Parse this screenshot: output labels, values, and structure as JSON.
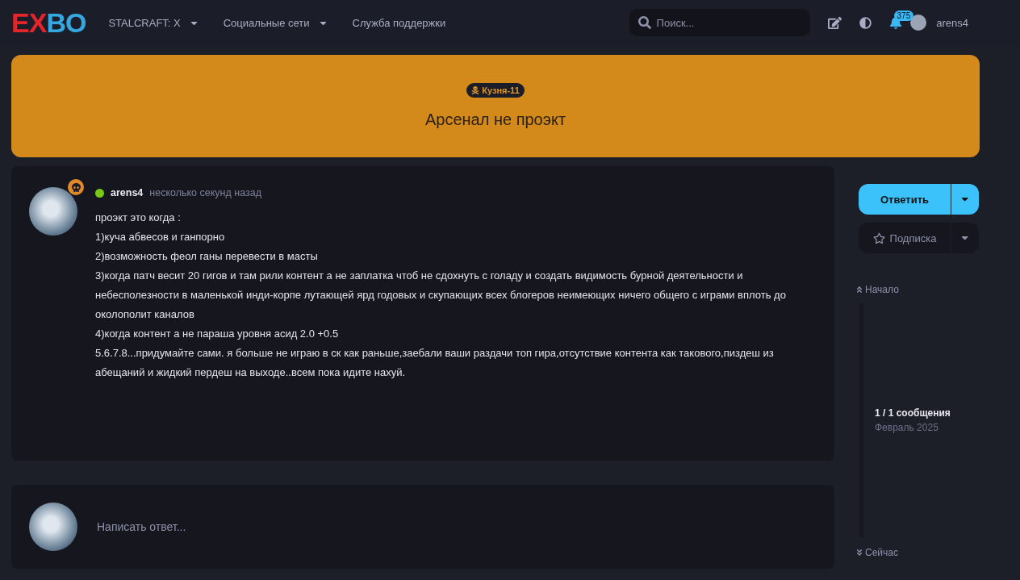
{
  "header": {
    "logo": "EXBO",
    "nav": [
      {
        "label": "STALCRAFT: X",
        "dropdown": true
      },
      {
        "label": "Социальные сети",
        "dropdown": true
      },
      {
        "label": "Служба поддержки",
        "dropdown": false
      }
    ],
    "search": {
      "placeholder": "Поиск..."
    },
    "notifications": "375",
    "username": "arens4"
  },
  "banner": {
    "tag": "Кузня-11",
    "title": "Арсенал не проэкт"
  },
  "post": {
    "author": "arens4",
    "online": true,
    "time": "несколько секунд назад",
    "lines": [
      "проэкт это когда :",
      "1)куча абвесов и ганпорно",
      "2)возможность феол ганы перевести в масты",
      "3)когда патч весит 20 гигов и там рили контент а не заплатка чтоб не сдохнуть с голаду и создать видимость бурной деятельности и небесполезности в маленькой инди-корпе лутающей ярд годовых и скупающих всех блогеров неимеющих ничего общего с играми вплоть до околополит каналов",
      "4)когда контент а не параша уровня асид 2.0 +0.5",
      "5.6.7.8...придумайте сами. я больше не играю в ск как раньше,заебали ваши раздачи топ гира,отсутствие контента как такового,пиздеш из абещаний и жидкий пердеш на выходе..всем пока идите нахуй."
    ]
  },
  "reply": {
    "placeholder": "Написать ответ..."
  },
  "sidebar": {
    "reply_button": "Ответить",
    "subscribe_button": "Подписка",
    "start": "Начало",
    "position": "1 / 1 сообщения",
    "date": "Февраль 2025",
    "end": "Сейчас"
  }
}
